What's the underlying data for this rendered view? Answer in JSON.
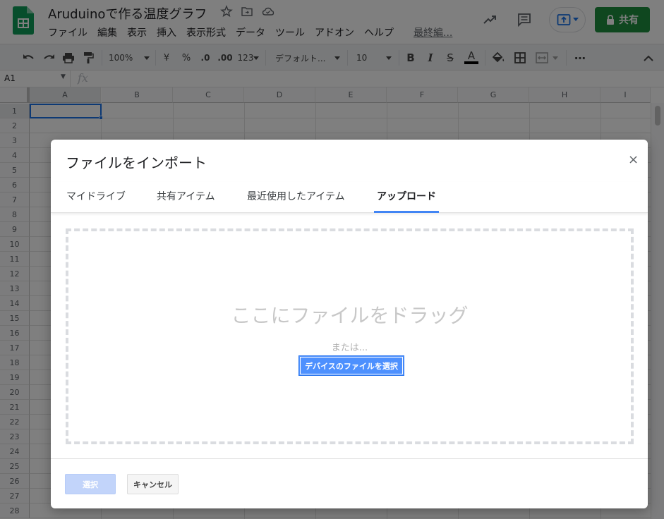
{
  "header": {
    "doc_title": "Aruduinoで作る温度グラフ",
    "menu": [
      "ファイル",
      "編集",
      "表示",
      "挿入",
      "表示形式",
      "データ",
      "ツール",
      "アドオン",
      "ヘルプ"
    ],
    "last_edit": "最終編...",
    "share_label": "共有"
  },
  "toolbar": {
    "zoom": "100%",
    "currency": "¥",
    "percent": "%",
    "dec_decrease": ".0",
    "dec_increase": ".00",
    "more_formats": "123",
    "font": "デフォルト...",
    "font_size": "10",
    "bold": "B",
    "italic": "I",
    "strike": "S",
    "text_color": "A",
    "more": "⋯"
  },
  "formula_bar": {
    "name_box": "A1",
    "fx_label": "fx"
  },
  "grid": {
    "columns": [
      "A",
      "B",
      "C",
      "D",
      "E",
      "F",
      "G",
      "H",
      "I"
    ],
    "rows": [
      "1",
      "2",
      "3",
      "4",
      "5",
      "6",
      "7",
      "8",
      "9",
      "10",
      "11",
      "12",
      "13",
      "14",
      "15",
      "16",
      "17",
      "18",
      "19",
      "20",
      "21",
      "22",
      "23",
      "24",
      "25",
      "26",
      "27",
      "28"
    ]
  },
  "dialog": {
    "title": "ファイルをインポート",
    "close": "×",
    "tabs": [
      "マイドライブ",
      "共有アイテム",
      "最近使用したアイテム",
      "アップロード"
    ],
    "active_tab": "アップロード",
    "drop_title": "ここにファイルをドラッグ",
    "drop_or": "または...",
    "device_button": "デバイスのファイルを選択",
    "select_button": "選択",
    "cancel_button": "キャンセル"
  },
  "colors": {
    "accent": "#4d90fe",
    "share_green": "#1e8e3e",
    "selection": "#1a73e8"
  }
}
